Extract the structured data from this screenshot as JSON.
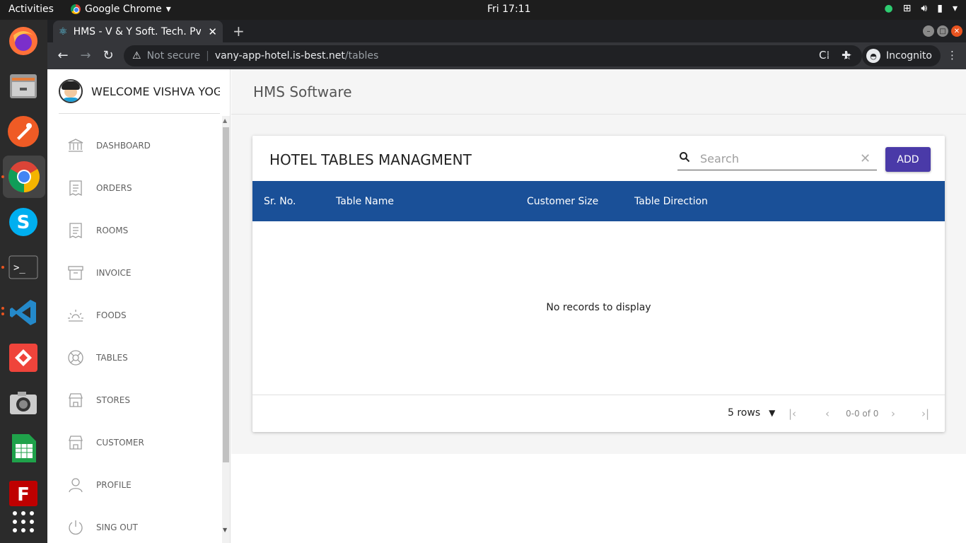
{
  "system": {
    "activities": "Activities",
    "app_menu": "Google Chrome",
    "clock": "Fri 17:11"
  },
  "browser": {
    "tab_title": "HMS - V & Y Soft. Tech. Pvt",
    "omnibox_security": "Not secure",
    "url_host": "vany-app-hotel.is-best.net",
    "url_path": "/tables",
    "incognito_label": "Incognito"
  },
  "sidebar": {
    "welcome": "WELCOME VISHVA YOGI",
    "items": [
      {
        "label": "DASHBOARD",
        "icon": "bank-icon"
      },
      {
        "label": "ORDERS",
        "icon": "receipt-icon"
      },
      {
        "label": "ROOMS",
        "icon": "receipt-icon"
      },
      {
        "label": "INVOICE",
        "icon": "archive-icon"
      },
      {
        "label": "FOODS",
        "icon": "sunrise-icon"
      },
      {
        "label": "TABLES",
        "icon": "lifebuoy-icon"
      },
      {
        "label": "STORES",
        "icon": "store-icon"
      },
      {
        "label": "CUSTOMER",
        "icon": "store-icon"
      },
      {
        "label": "PROFILE",
        "icon": "user-icon"
      },
      {
        "label": "SING OUT",
        "icon": "power-icon"
      }
    ]
  },
  "header": {
    "title": "HMS Software"
  },
  "card": {
    "title": "HOTEL TABLES MANAGMENT",
    "search_placeholder": "Search",
    "add_label": "ADD",
    "columns": [
      "Sr. No.",
      "Table Name",
      "Customer Size",
      "Table Direction"
    ],
    "empty_message": "No records to display",
    "rows_per_page": "5 rows",
    "page_info": "0-0 of 0"
  },
  "colors": {
    "table_header": "#1a5098",
    "add_button": "#4a3aa8"
  }
}
